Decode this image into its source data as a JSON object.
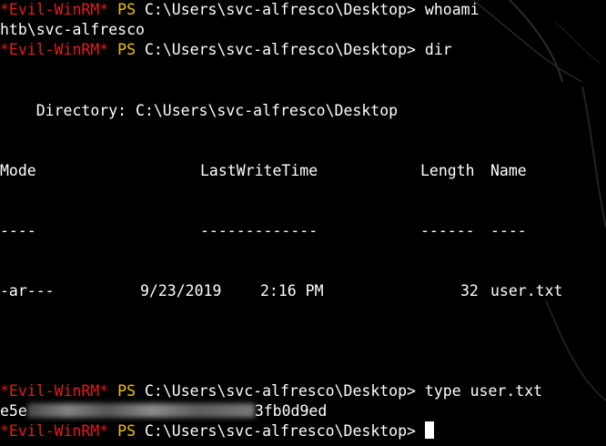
{
  "colors": {
    "background": "#000000",
    "prompt_tag": "#e31c1c",
    "ps": "#f0c000",
    "text": "#ffffff"
  },
  "prompt": {
    "tag": "*Evil-WinRM*",
    "ps": "PS",
    "path": "C:\\Users\\svc-alfresco\\Desktop>"
  },
  "commands": {
    "whoami": "whoami",
    "dir": "dir",
    "type": "type user.txt"
  },
  "outputs": {
    "whoami_result": "htb\\svc-alfresco",
    "directory_line": "    Directory: C:\\Users\\svc-alfresco\\Desktop",
    "header_mode": "Mode",
    "header_lastwrite": "LastWriteTime",
    "header_length": "Length",
    "header_name": "Name",
    "sep_mode": "----",
    "sep_lastwrite": "-------------",
    "sep_length": "------",
    "sep_name": "----",
    "row_mode": "-ar---",
    "row_date": "9/23/2019",
    "row_time": "2:16 PM",
    "row_length": "32",
    "row_name": "user.txt",
    "hash_prefix": "e5e",
    "hash_suffix": "3fb0d9ed"
  }
}
